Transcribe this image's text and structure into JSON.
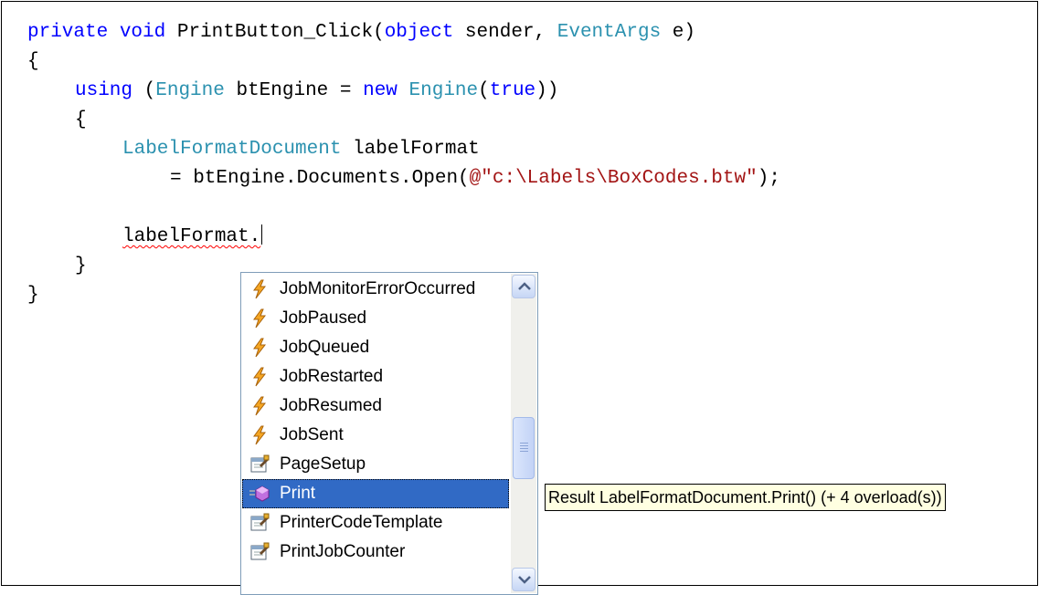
{
  "code": {
    "line1": {
      "kw1": "private",
      "kw2": "void",
      "method": "PrintButton_Click(",
      "type1": "object",
      "param1": " sender, ",
      "type2": "EventArgs",
      "param2": " e)"
    },
    "line2": "{",
    "line3": {
      "kw": "using",
      "open": " (",
      "type": "Engine",
      "mid": " btEngine = ",
      "kw_new": "new",
      "type2": "Engine",
      "paren": "(",
      "kw_true": "true",
      "close": "))"
    },
    "line4": "{",
    "line5": {
      "type": "LabelFormatDocument",
      "rest": " labelFormat"
    },
    "line6": {
      "pre": "= btEngine.Documents.Open(",
      "str": "@\"c:\\Labels\\BoxCodes.btw\"",
      "post": ");"
    },
    "line7": "labelFormat.",
    "line8": "}",
    "line9": "}"
  },
  "completion": {
    "items": [
      {
        "label": "JobMonitorErrorOccurred",
        "icon": "event-icon"
      },
      {
        "label": "JobPaused",
        "icon": "event-icon"
      },
      {
        "label": "JobQueued",
        "icon": "event-icon"
      },
      {
        "label": "JobRestarted",
        "icon": "event-icon"
      },
      {
        "label": "JobResumed",
        "icon": "event-icon"
      },
      {
        "label": "JobSent",
        "icon": "event-icon"
      },
      {
        "label": "PageSetup",
        "icon": "property-icon"
      },
      {
        "label": "Print",
        "icon": "method-icon",
        "selected": true
      },
      {
        "label": "PrinterCodeTemplate",
        "icon": "property-icon"
      },
      {
        "label": "PrintJobCounter",
        "icon": "property-icon"
      }
    ]
  },
  "tooltip": "Result LabelFormatDocument.Print() (+ 4 overload(s))",
  "colors": {
    "keyword": "#0000ff",
    "type": "#2b91af",
    "string": "#a31515",
    "selection": "#316ac5",
    "tooltip_bg": "#ffffe1"
  }
}
